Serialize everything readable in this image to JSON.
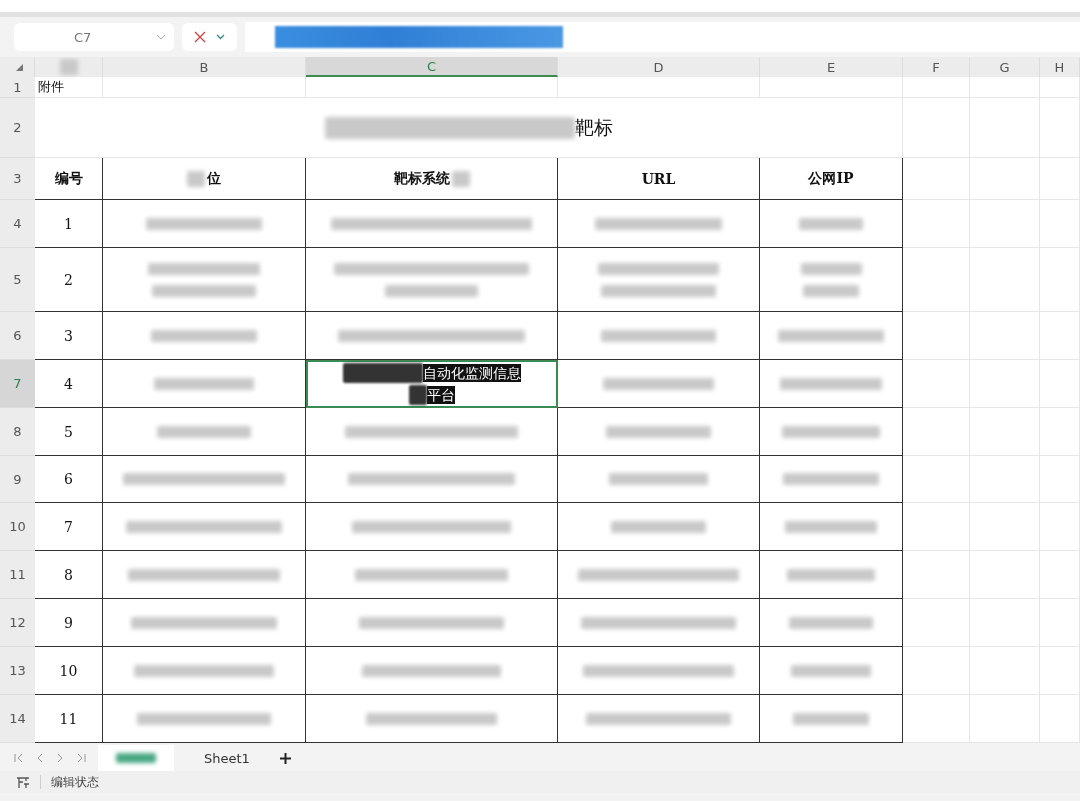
{
  "formula_bar": {
    "cell_ref": "C7"
  },
  "columns": [
    {
      "label": "B",
      "selected": false
    },
    {
      "label": "C",
      "selected": true
    },
    {
      "label": "D",
      "selected": false
    },
    {
      "label": "E",
      "selected": false
    },
    {
      "label": "F",
      "selected": false
    },
    {
      "label": "G",
      "selected": false
    },
    {
      "label": "H",
      "selected": false
    }
  ],
  "row_numbers": [
    {
      "label": "1",
      "selected": false
    },
    {
      "label": "2",
      "selected": false
    },
    {
      "label": "3",
      "selected": false
    },
    {
      "label": "4",
      "selected": false
    },
    {
      "label": "5",
      "selected": false
    },
    {
      "label": "6",
      "selected": false
    },
    {
      "label": "7",
      "selected": true
    },
    {
      "label": "8",
      "selected": false
    },
    {
      "label": "9",
      "selected": false
    },
    {
      "label": "10",
      "selected": false
    },
    {
      "label": "11",
      "selected": false
    },
    {
      "label": "12",
      "selected": false
    },
    {
      "label": "13",
      "selected": false
    },
    {
      "label": "14",
      "selected": false
    }
  ],
  "note": "附件",
  "title": "靶标",
  "headers": [
    "编号",
    "位",
    "靶标系统",
    "URL",
    "公网IP"
  ],
  "records": [
    {
      "number": "1"
    },
    {
      "number": "2"
    },
    {
      "number": "3"
    },
    {
      "number": "4",
      "system_lines": [
        "自动化监测信息",
        "平台"
      ]
    },
    {
      "number": "5"
    },
    {
      "number": "6"
    },
    {
      "number": "7"
    },
    {
      "number": "8"
    },
    {
      "number": "9"
    },
    {
      "number": "10"
    },
    {
      "number": "11"
    }
  ],
  "sheet_tabs": [
    {
      "kind": "redacted",
      "selected": true
    },
    {
      "kind": "named",
      "label": "Sheet1",
      "selected": false
    }
  ],
  "status_bar": {
    "mode": "编辑状态"
  }
}
